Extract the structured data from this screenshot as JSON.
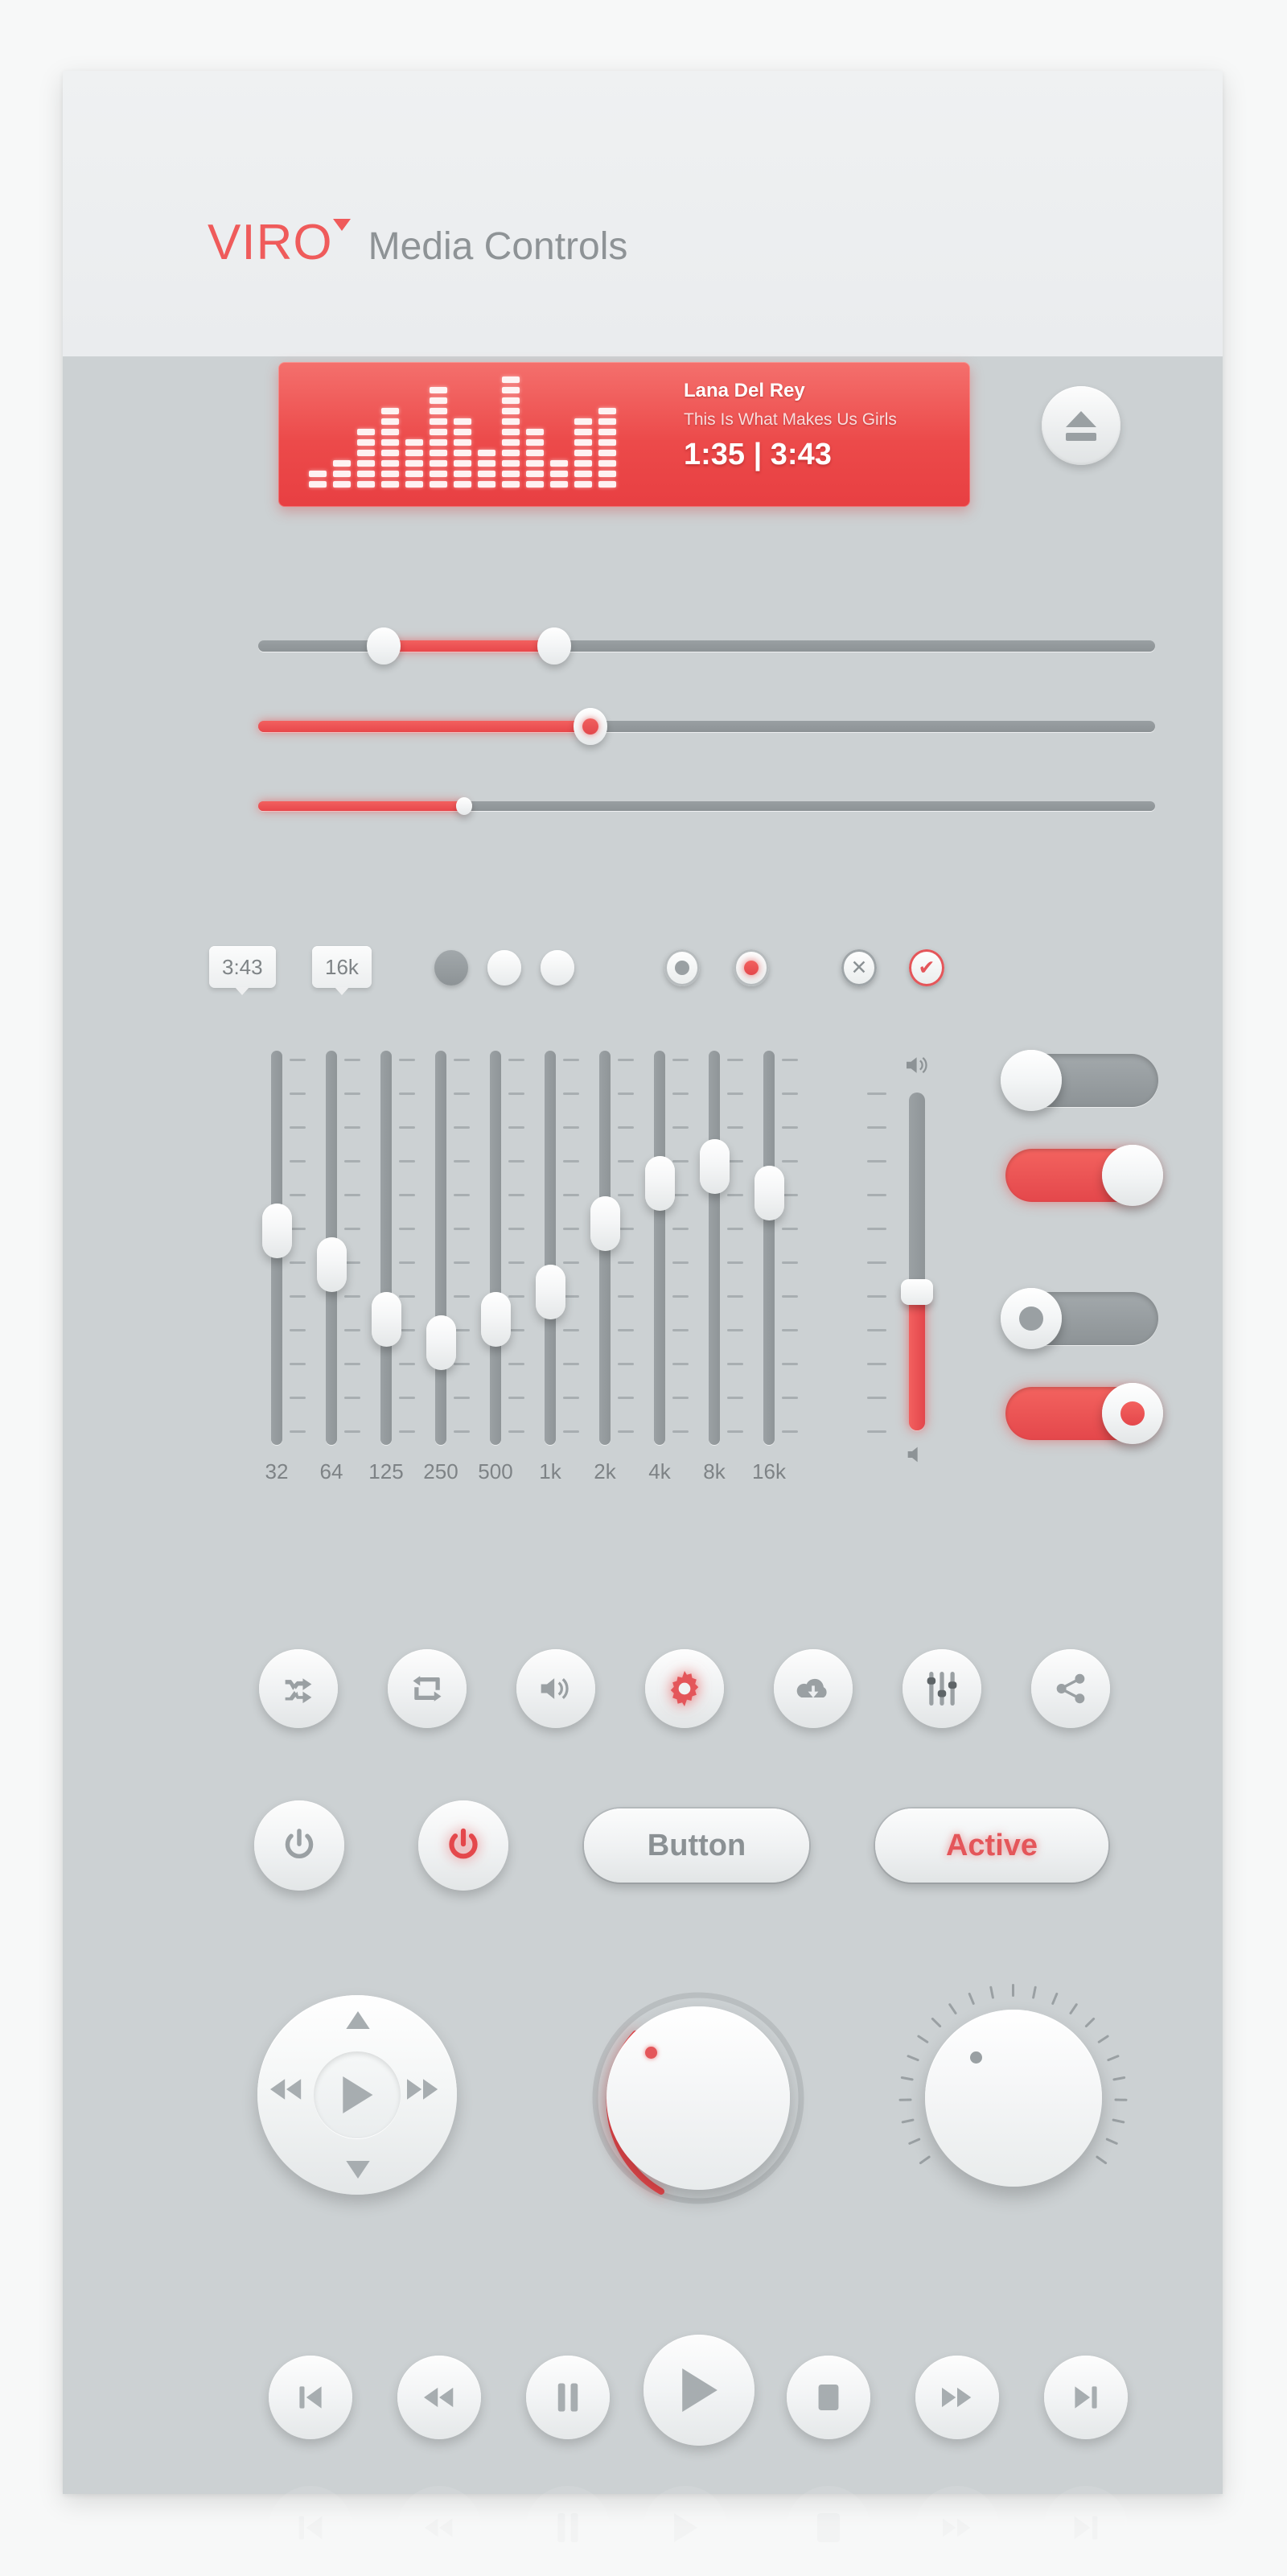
{
  "header": {
    "logo": "VIRO",
    "subtitle": "Media Controls",
    "logo_color": "#ef5b5b",
    "subtitle_color": "#8e9396"
  },
  "player": {
    "artist": "Lana Del Rey",
    "title": "This Is What Makes Us Girls",
    "time": "1:35 | 3:43",
    "elapsed": "1:35",
    "duration": "3:43",
    "accent_color": "#ec4a4a",
    "equalizer_bars": [
      2,
      3,
      6,
      8,
      5,
      10,
      7,
      4,
      11,
      6,
      3,
      7,
      8
    ]
  },
  "eject": {
    "label": "Eject",
    "icon": "eject-icon"
  },
  "sliders": [
    {
      "name": "range-slider",
      "type": "range",
      "start_pct": 14,
      "end_pct": 33,
      "knobs": 2
    },
    {
      "name": "value-slider",
      "type": "single",
      "value_pct": 37,
      "knob_style": "red-center"
    },
    {
      "name": "thin-slider",
      "type": "single",
      "value_pct": 23,
      "knob_style": "small"
    }
  ],
  "chips": [
    {
      "name": "duration-tooltip",
      "label": "3:43"
    },
    {
      "name": "frequency-tooltip",
      "label": "16k"
    }
  ],
  "dots": [
    {
      "name": "dot-indicator-1",
      "state": "off"
    },
    {
      "name": "dot-indicator-2",
      "state": "on"
    },
    {
      "name": "dot-indicator-3",
      "state": "on"
    }
  ],
  "radios": [
    {
      "name": "radio-inactive",
      "state": "gray"
    },
    {
      "name": "radio-active",
      "state": "red"
    }
  ],
  "confirm_buttons": [
    {
      "name": "cancel-button",
      "glyph": "✕",
      "style": "gray"
    },
    {
      "name": "confirm-button",
      "glyph": "✔",
      "style": "red"
    }
  ],
  "equalizer": {
    "bands": [
      "32",
      "64",
      "125",
      "250",
      "500",
      "1k",
      "2k",
      "4k",
      "8k",
      "16k"
    ],
    "values": [
      55,
      45,
      29,
      22,
      29,
      37,
      57,
      69,
      74,
      66
    ]
  },
  "volume": {
    "label": "Volume",
    "value_pct": 41,
    "icon_high": "volume-high-icon",
    "icon_low": "volume-low-icon"
  },
  "toggles": [
    {
      "name": "toggle-off-plain",
      "state": "off",
      "style": "plain"
    },
    {
      "name": "toggle-on-plain",
      "state": "on",
      "style": "plain"
    },
    {
      "name": "toggle-off-ring",
      "state": "off",
      "style": "ring"
    },
    {
      "name": "toggle-on-ring",
      "state": "on",
      "style": "ring"
    }
  ],
  "icon_buttons": [
    {
      "name": "shuffle-icon",
      "active": false
    },
    {
      "name": "repeat-icon",
      "active": false
    },
    {
      "name": "volume-icon",
      "active": false
    },
    {
      "name": "gear-icon",
      "active": true
    },
    {
      "name": "cloud-download-icon",
      "active": false
    },
    {
      "name": "equalizer-icon",
      "active": false
    },
    {
      "name": "share-icon",
      "active": false
    }
  ],
  "power_buttons": [
    {
      "name": "power-button-off",
      "state": "off"
    },
    {
      "name": "power-button-on",
      "state": "on"
    }
  ],
  "pills": [
    {
      "name": "button-default",
      "label": "Button",
      "active": false
    },
    {
      "name": "button-active",
      "label": "Active",
      "active": true
    }
  ],
  "dpad": {
    "up": "up-icon",
    "down": "down-icon",
    "rewind": "rewind-icon",
    "forward": "forward-icon",
    "center": "play-icon"
  },
  "knobs": [
    {
      "name": "knob-with-arc",
      "indicator_color": "#e4565a",
      "arc_color": "#e4474b",
      "arc_pct": 30
    },
    {
      "name": "knob-with-ticks",
      "indicator_color": "#9aa0a3",
      "tick_count": 23
    }
  ],
  "transport": [
    {
      "name": "previous-track-button",
      "icon": "previous-icon",
      "size": "small"
    },
    {
      "name": "rewind-button",
      "icon": "rewind-icon",
      "size": "small"
    },
    {
      "name": "pause-button",
      "icon": "pause-icon",
      "size": "small"
    },
    {
      "name": "play-button",
      "icon": "play-icon",
      "size": "large"
    },
    {
      "name": "stop-button",
      "icon": "stop-icon",
      "size": "small"
    },
    {
      "name": "fast-forward-button",
      "icon": "fast-forward-icon",
      "size": "small"
    },
    {
      "name": "next-track-button",
      "icon": "next-icon",
      "size": "small"
    }
  ],
  "colors": {
    "panel_bg": "#ccd1d3",
    "header_bg": "#eceef0",
    "accent_red": "#e4565a",
    "track_gray": "#939a9d",
    "text_gray": "#7e8386"
  }
}
